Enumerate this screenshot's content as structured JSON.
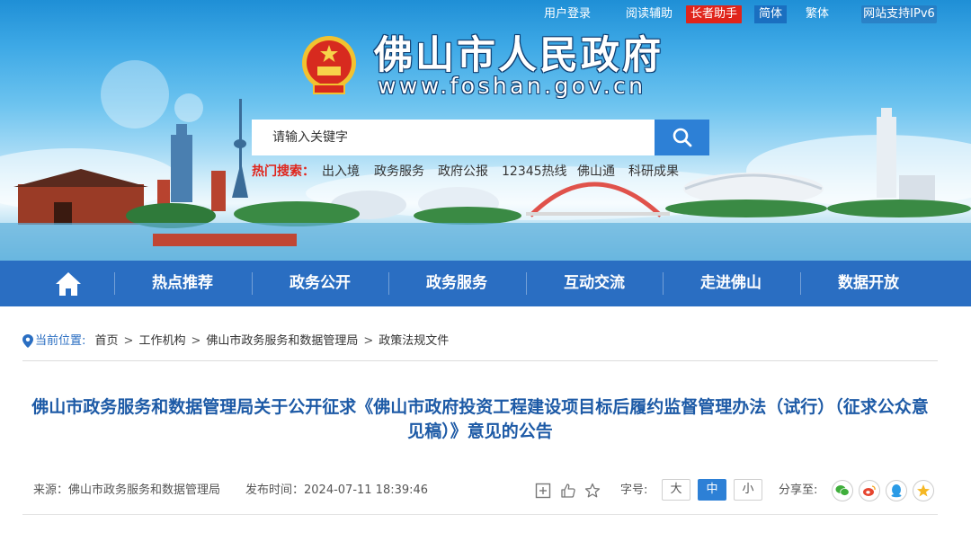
{
  "top_links": {
    "login": "用户登录",
    "reading_aid": "阅读辅助",
    "elder_assistant": "长者助手",
    "simplified": "简体",
    "traditional": "繁体",
    "ipv6": "网站支持IPv6"
  },
  "site": {
    "title": "佛山市人民政府",
    "url": "www.foshan.gov.cn"
  },
  "search": {
    "placeholder": "请输入关键字",
    "hot_label": "热门搜索：",
    "hot_items": [
      "出入境",
      "政务服务",
      "政府公报",
      "12345热线",
      "佛山通",
      "科研成果"
    ]
  },
  "nav": {
    "items": [
      "热点推荐",
      "政务公开",
      "政务服务",
      "互动交流",
      "走进佛山",
      "数据开放"
    ]
  },
  "breadcrumb": {
    "label": "当前位置:",
    "items": [
      "首页",
      "工作机构",
      "佛山市政务服务和数据管理局",
      "政策法规文件"
    ]
  },
  "article": {
    "title": "佛山市政务服务和数据管理局关于公开征求《佛山市政府投资工程建设项目标后履约监督管理办法（试行）（征求公众意见稿）》意见的公告",
    "source": "来源：佛山市政务服务和数据管理局",
    "publish_time": "发布时间：2024-07-11 18:39:46",
    "font_size_label": "字号:",
    "font_sizes": [
      "大",
      "中",
      "小"
    ],
    "active_font_size": "中",
    "share_label": "分享至:"
  },
  "colors": {
    "nav_bg": "#2a6ec2",
    "accent": "#2d80d6",
    "elder_badge": "#e0241b",
    "title": "#1d5aa6",
    "hot_label": "#e0241b"
  },
  "icons": {
    "home": "home-icon",
    "search": "search-icon",
    "location": "location-pin-icon",
    "tools": [
      "print-icon",
      "like-icon",
      "favorite-star-icon"
    ],
    "share": [
      "wechat-icon",
      "weibo-icon",
      "qq-icon",
      "qzone-icon"
    ]
  }
}
